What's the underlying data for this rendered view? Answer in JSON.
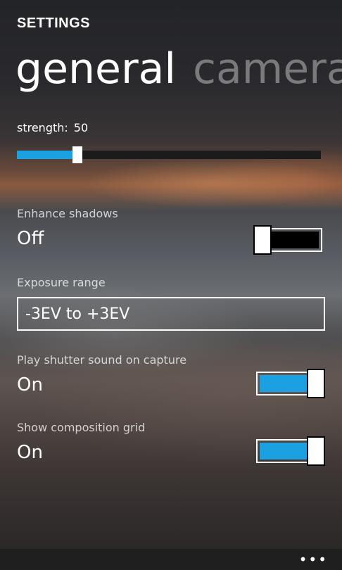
{
  "app_title": "SETTINGS",
  "pivot": {
    "active": "general",
    "inactive": "camera"
  },
  "strength": {
    "label": "strength:",
    "value": "50",
    "fraction": 0.2
  },
  "enhance_shadows": {
    "label": "Enhance shadows",
    "state": "Off",
    "on": false
  },
  "exposure_range": {
    "label": "Exposure range",
    "value": "-3EV to +3EV"
  },
  "shutter_sound": {
    "label": "Play shutter sound on capture",
    "state": "On",
    "on": true
  },
  "composition_grid": {
    "label": "Show composition grid",
    "state": "On",
    "on": true
  },
  "appbar": {
    "more_icon": "ellipsis-icon",
    "more_glyph": "•••"
  },
  "colors": {
    "accent": "#1ba1e2",
    "background": "#1f1f1f",
    "text": "#ffffff"
  }
}
